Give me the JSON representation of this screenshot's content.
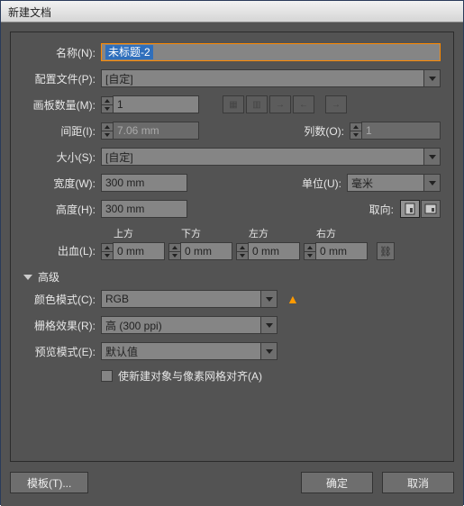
{
  "window": {
    "title": "新建文档"
  },
  "fields": {
    "name_label": "名称(N):",
    "name_value": "未标题-2",
    "profile_label": "配置文件(P):",
    "profile_value": "[自定]",
    "artboard_count_label": "画板数量(M):",
    "artboard_count_value": "1",
    "spacing_label": "间距(I):",
    "spacing_value": "7.06 mm",
    "columns_label": "列数(O):",
    "columns_value": "1",
    "size_label": "大小(S):",
    "size_value": "[自定]",
    "width_label": "宽度(W):",
    "width_value": "300 mm",
    "units_label": "单位(U):",
    "units_value": "毫米",
    "height_label": "高度(H):",
    "height_value": "300 mm",
    "orientation_label": "取向:",
    "bleed_label": "出血(L):",
    "bleed_top": "上方",
    "bleed_bottom": "下方",
    "bleed_left": "左方",
    "bleed_right": "右方",
    "bleed_value": "0 mm"
  },
  "advanced": {
    "heading": "高级",
    "color_mode_label": "颜色模式(C):",
    "color_mode_value": "RGB",
    "raster_label": "栅格效果(R):",
    "raster_value": "高 (300 ppi)",
    "preview_label": "预览模式(E):",
    "preview_value": "默认值",
    "align_pixel_label": "使新建对象与像素网格对齐(A)"
  },
  "buttons": {
    "templates": "模板(T)...",
    "ok": "确定",
    "cancel": "取消"
  },
  "icons": {
    "link": "⛓"
  }
}
